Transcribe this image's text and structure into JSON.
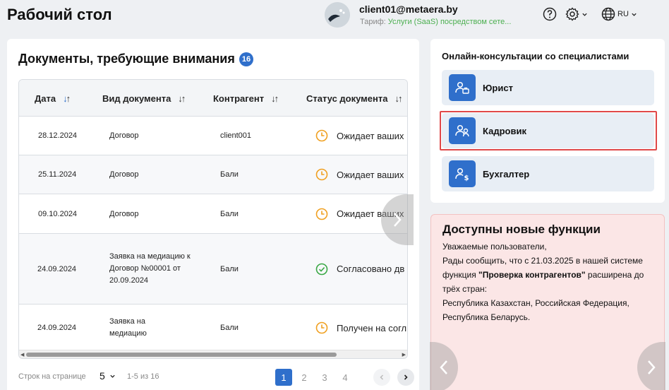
{
  "header": {
    "title": "Рабочий стол",
    "user_email": "client01@metaera.by",
    "plan_label": "Тариф:",
    "plan_value": "Услуги (SaaS) посредством сете...",
    "language": "RU",
    "icons": [
      "help-icon",
      "gear-icon",
      "globe-icon"
    ]
  },
  "documents": {
    "title": "Документы, требующие внимания",
    "count": "16",
    "columns": [
      "Дата",
      "Вид документа",
      "Контрагент",
      "Статус документа"
    ],
    "rows": [
      {
        "date": "28.12.2024",
        "type": "Договор",
        "counterparty": "client001",
        "status": "Ожидает ваших",
        "status_icon": "clock-icon"
      },
      {
        "date": "25.11.2024",
        "type": "Договор",
        "counterparty": "Бали",
        "status": "Ожидает ваших",
        "status_icon": "clock-icon"
      },
      {
        "date": "09.10.2024",
        "type": "Договор",
        "counterparty": "Бали",
        "status": "Ожидает ваших",
        "status_icon": "clock-icon"
      },
      {
        "date": "24.09.2024",
        "type": "Заявка на медиацию к Договор №00001 от 20.09.2024",
        "counterparty": "Бали",
        "status": "Согласовано дв",
        "status_icon": "check-circle-icon"
      },
      {
        "date": "24.09.2024",
        "type": "Заявка на медиацию",
        "counterparty": "Бали",
        "status": "Получен на согл",
        "status_icon": "clock-icon"
      }
    ],
    "pagination": {
      "rows_label": "Строк на странице",
      "rows_value": "5",
      "range": "1-5 из 16",
      "pages": [
        "1",
        "2",
        "3",
        "4"
      ],
      "current_page": "1"
    }
  },
  "consultations": {
    "title": "Онлайн-консультации со специалистами",
    "items": [
      {
        "label": "Юрист",
        "icon": "lawyer-icon"
      },
      {
        "label": "Кадровик",
        "icon": "hr-icon"
      },
      {
        "label": "Бухгалтер",
        "icon": "accountant-icon"
      }
    ]
  },
  "news": {
    "title": "Доступны новые функции",
    "greeting": "Уважаемые пользователи,",
    "text_before": "Рады сообщить, что с 21.03.2025 в нашей системе функция ",
    "highlight": "\"Проверка контрагентов\"",
    "text_after": " расширена до трёх стран:",
    "countries": "Республика Казахстан, Российская Федерация, Республика Беларусь."
  },
  "colors": {
    "accent": "#2f6fcb",
    "pending": "#f0a020",
    "approved": "#3aa845",
    "highlight_border": "#e04848",
    "news_bg": "#fbe6e6"
  }
}
